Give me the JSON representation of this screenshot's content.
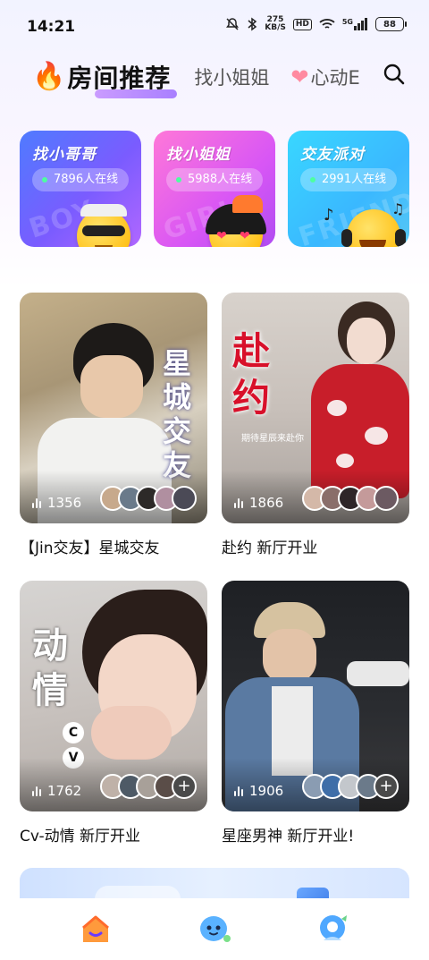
{
  "status": {
    "time": "14:21",
    "speed_top": "275",
    "speed_unit": "KB/S",
    "hd": "HD",
    "network": "5G",
    "battery": "88"
  },
  "tabs": {
    "active": "房间推荐",
    "second": "找小姐姐",
    "third": "心动E"
  },
  "categories": [
    {
      "title": "找小哥哥",
      "online": "7896人在线",
      "bg_text": "BOY"
    },
    {
      "title": "找小姐姐",
      "online": "5988人在线",
      "bg_text": "GIRL"
    },
    {
      "title": "交友派对",
      "online": "2991人在线",
      "bg_text": "FRIEND"
    }
  ],
  "rooms": [
    {
      "name": "【Jin交友】星城交友",
      "count": "1356",
      "overlay": "星城交友"
    },
    {
      "name": "赴约 新厅开业",
      "count": "1866",
      "overlay": "赴约",
      "overlay_small": "期待星辰来赴你"
    },
    {
      "name": "Cv-动情 新厅开业",
      "count": "1762",
      "overlay": "动情"
    },
    {
      "name": "星座男神 新厅开业!",
      "count": "1906",
      "overlay": ""
    }
  ],
  "colors": {
    "accent_purple": "#9b6bff",
    "online_dot": "#4dffa0"
  },
  "icons": {
    "search": "search-icon",
    "nav": [
      "home-icon",
      "chat-bubble-icon",
      "profile-icon"
    ]
  }
}
